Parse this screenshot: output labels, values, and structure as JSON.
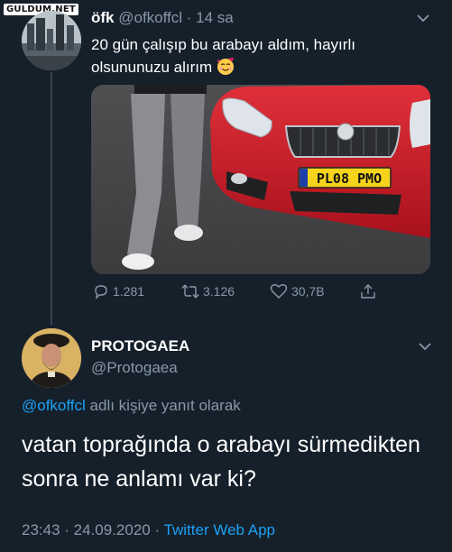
{
  "watermark": "GULDUM.NET",
  "original_tweet": {
    "display_name": "öfk",
    "handle": "@ofkoffcl",
    "separator": " · ",
    "time_ago": "14 sa",
    "text": "20 gün çalışıp bu arabayı aldım, hayırlı olsununuzu alırım",
    "emoji_icon": "smiling-face-with-hearts-icon",
    "photo_plate": "PL08 PMO",
    "stats": {
      "replies": "1.281",
      "retweets": "3.126",
      "likes": "30,7B"
    }
  },
  "reply_tweet": {
    "display_name": "PROTOGAEA",
    "handle": "@Protogaea",
    "reply_to_mention": "@ofkoffcl",
    "reply_to_suffix": " adlı kişiye yanıt olarak",
    "text": "vatan toprağında o arabayı sürmedikten sonra ne anlamı var ki?",
    "timestamp": "23:43 · 24.09.2020 · ",
    "source": "Twitter Web App"
  },
  "colors": {
    "background": "#15202b",
    "secondary_text": "#8899a6",
    "link": "#1da1f2",
    "thread_line": "#38444d"
  }
}
